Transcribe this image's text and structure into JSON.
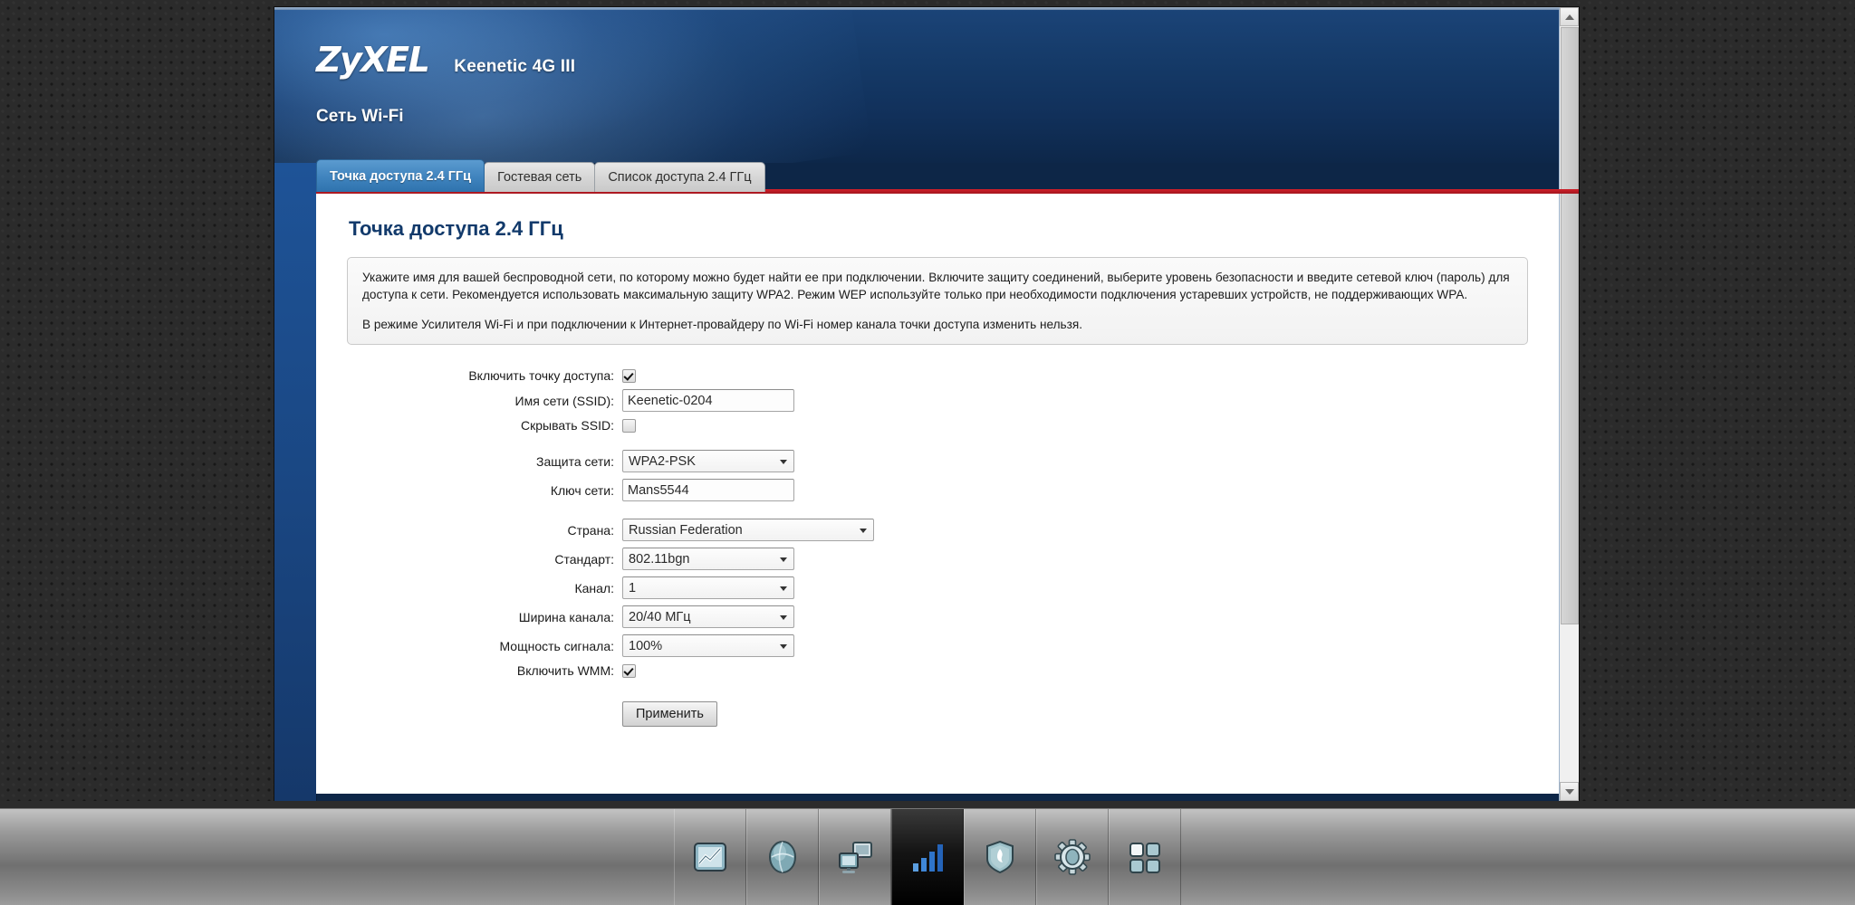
{
  "header": {
    "logo_text": "ZyXEL",
    "model": "Keenetic 4G III",
    "section_title": "Сеть Wi-Fi"
  },
  "tabs": [
    {
      "label": "Точка доступа 2.4 ГГц",
      "active": true
    },
    {
      "label": "Гостевая сеть",
      "active": false
    },
    {
      "label": "Список доступа 2.4 ГГц",
      "active": false
    }
  ],
  "page": {
    "heading": "Точка доступа 2.4 ГГц",
    "info_paragraph_1": "Укажите имя для вашей беспроводной сети, по которому можно будет найти ее при подключении. Включите защиту соединений, выберите уровень безопасности и введите сетевой ключ (пароль) для доступа к сети. Рекомендуется использовать максимальную защиту WPA2. Режим WEP используйте только при необходимости подключения устаревших устройств, не поддерживающих WPA.",
    "info_paragraph_2": "В режиме Усилителя Wi-Fi и при подключении к Интернет-провайдеру по Wi-Fi номер канала точки доступа изменить нельзя."
  },
  "form": {
    "enable_ap_label": "Включить точку доступа:",
    "enable_ap_checked": true,
    "ssid_label": "Имя сети (SSID):",
    "ssid_value": "Keenetic-0204",
    "hide_ssid_label": "Скрывать SSID:",
    "hide_ssid_checked": false,
    "security_label": "Защита сети:",
    "security_value": "WPA2-PSK",
    "key_label": "Ключ сети:",
    "key_value": "Mans5544",
    "country_label": "Страна:",
    "country_value": "Russian Federation",
    "standard_label": "Стандарт:",
    "standard_value": "802.11bgn",
    "channel_label": "Канал:",
    "channel_value": "1",
    "channel_width_label": "Ширина канала:",
    "channel_width_value": "20/40 МГц",
    "signal_power_label": "Мощность сигнала:",
    "signal_power_value": "100%",
    "wmm_label": "Включить WMM:",
    "wmm_checked": true,
    "apply_label": "Применить"
  },
  "taskbar": {
    "items": [
      {
        "icon": "monitor-chart-icon",
        "active": false
      },
      {
        "icon": "globe-internet-icon",
        "active": false
      },
      {
        "icon": "home-network-icon",
        "active": false
      },
      {
        "icon": "wifi-signal-bars-icon",
        "active": true
      },
      {
        "icon": "shield-firewall-icon",
        "active": false
      },
      {
        "icon": "gear-settings-icon",
        "active": false
      },
      {
        "icon": "apps-grid-icon",
        "active": false
      }
    ]
  },
  "colors": {
    "accent_red": "#c41e28",
    "tab_active_blue": "#3f83bd",
    "header_navy": "#153a68",
    "heading_blue": "#123a6b"
  }
}
